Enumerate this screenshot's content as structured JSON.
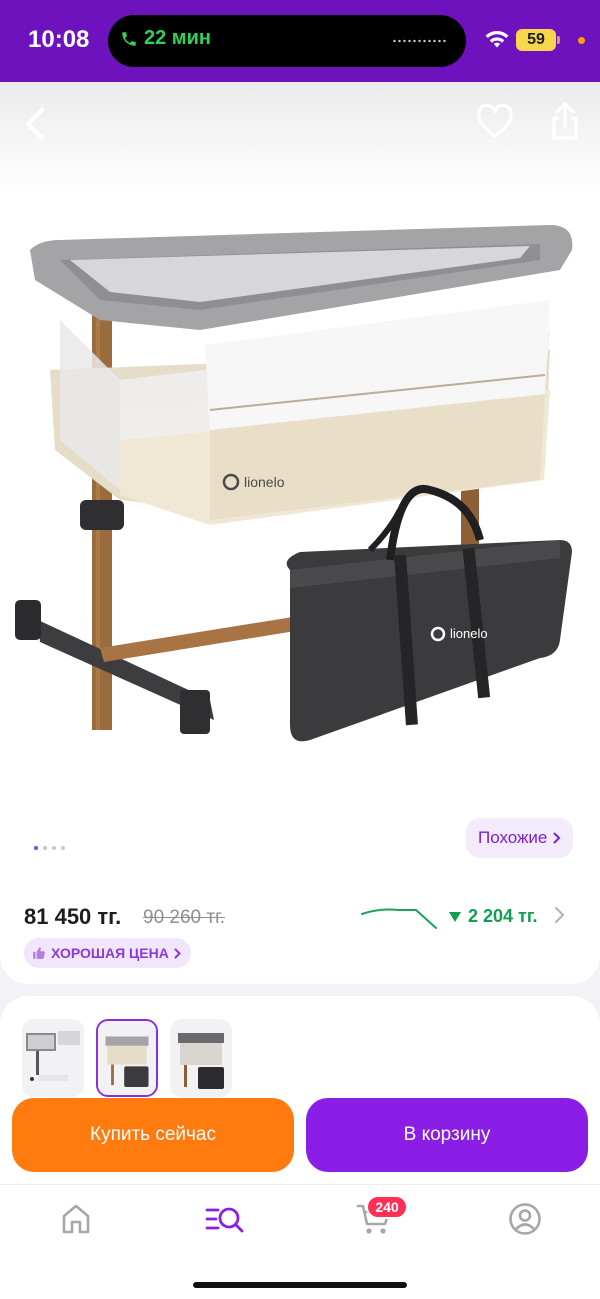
{
  "status_bar": {
    "time": "10:08",
    "call_duration": "22 мин",
    "battery": "59",
    "icons": [
      "phone-icon",
      "wifi-icon",
      "battery-icon"
    ]
  },
  "header": {
    "icons": [
      "back-arrow-icon",
      "heart-icon",
      "share-icon"
    ]
  },
  "gallery": {
    "brand_logo_text": "lionelo",
    "similar_label": "Похожие",
    "pages_total": 4,
    "active_page": 1
  },
  "price": {
    "current": "81 450 тг.",
    "old": "90 260 тг.",
    "drop": "2 204 тг.",
    "badge": "ХОРОШАЯ ЦЕНА"
  },
  "variants": {
    "count": 3,
    "selected_index": 1
  },
  "actions": {
    "buy_now": "Купить сейчас",
    "add_to_cart": "В корзину"
  },
  "nav": {
    "items": [
      "home-icon",
      "catalog-search-icon",
      "cart-icon",
      "profile-icon"
    ],
    "active": "catalog-search-icon",
    "cart_count": "240"
  },
  "colors": {
    "brand_purple": "#6d12bd",
    "accent_purple": "#8a1ee6",
    "orange": "#ff7b0f",
    "price_drop_green": "#0f9f52",
    "badge_red": "#ff2f55"
  }
}
